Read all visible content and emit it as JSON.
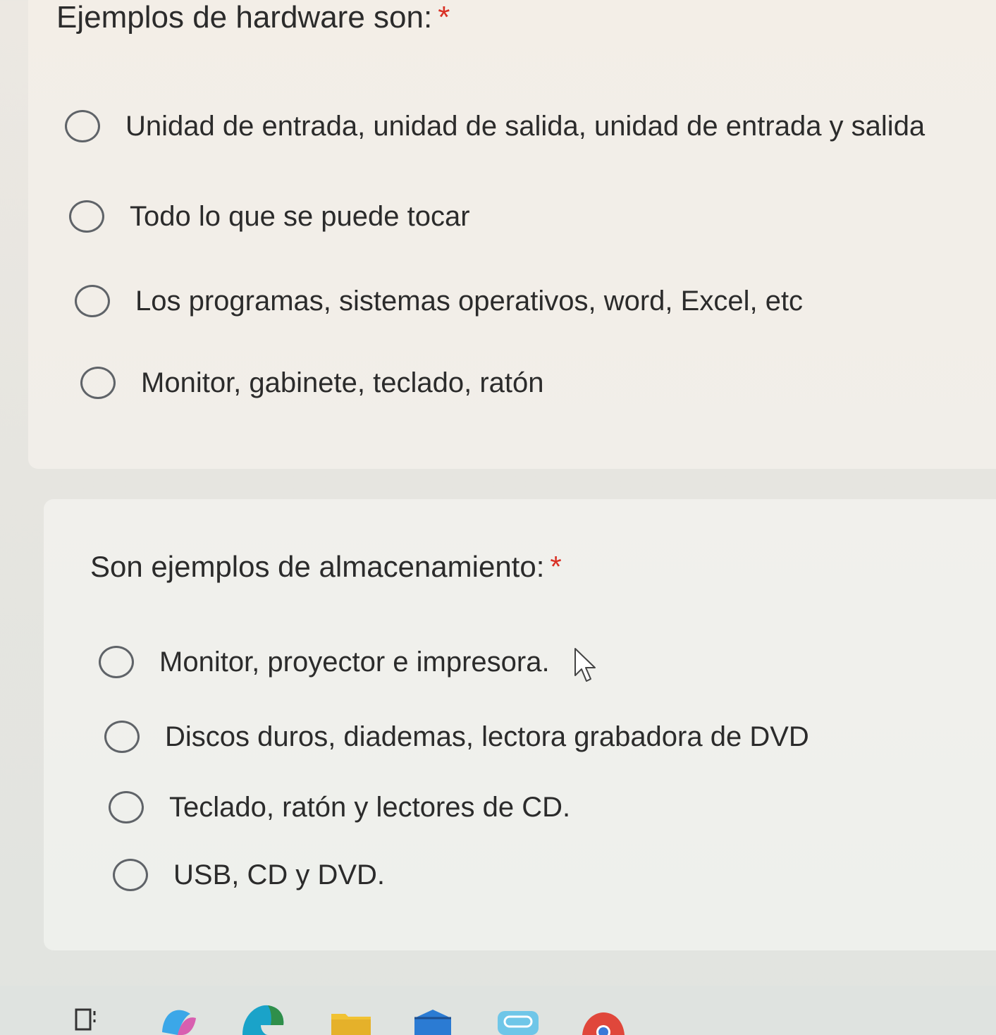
{
  "q1": {
    "title": "Ejemplos de hardware son:",
    "required_mark": "*",
    "options": [
      "Unidad de entrada, unidad de salida, unidad de entrada y salida",
      "Todo lo que se puede tocar",
      "Los programas, sistemas operativos, word, Excel, etc",
      "Monitor, gabinete, teclado, ratón"
    ]
  },
  "q2": {
    "title": "Son ejemplos de almacenamiento:",
    "required_mark": "*",
    "options": [
      "Monitor, proyector e impresora.",
      "Discos duros, diademas, lectora grabadora de DVD",
      "Teclado, ratón y lectores de CD.",
      "USB, CD y DVD."
    ]
  },
  "taskbar": {
    "icons": [
      "task-view-icon",
      "copilot-icon",
      "edge-icon",
      "file-explorer-icon",
      "store-icon",
      "app-icon",
      "chrome-icon"
    ]
  },
  "colors": {
    "required": "#d93025",
    "text": "#2b2b2b",
    "radio_border": "#5f6368"
  }
}
